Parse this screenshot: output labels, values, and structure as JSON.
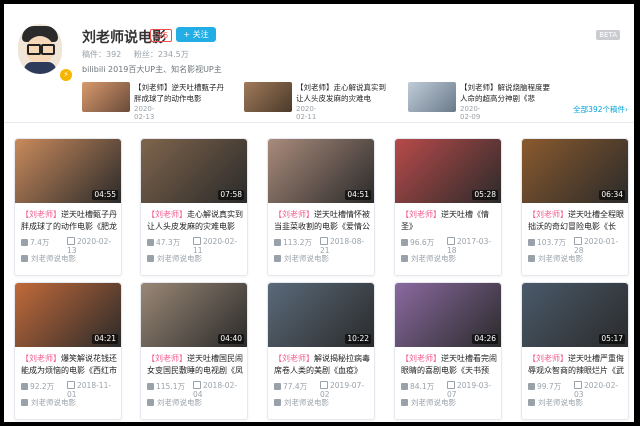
{
  "profile": {
    "name": "刘老师说电影",
    "level": "LV6",
    "follow_label": "+ 关注",
    "beta": "BETA",
    "uploads_label": "稿件：392",
    "fans_label": "粉丝：234.5万",
    "sign": "bilibili 2019百大UP主、知名影视UP主"
  },
  "recent": [
    {
      "title": "【刘老师】逆天吐槽甄子丹胖成球了的动作电影",
      "date": "2020-02-13",
      "color": "#c98a5c"
    },
    {
      "title": "【刘老师】走心解说真实到让人头皮发麻的灾难电",
      "date": "2020-02-11",
      "color": "#8a6a4e"
    },
    {
      "title": "【刘老师】解说烧脑程度要人命的超高分神剧《悲",
      "date": "2020-02-09",
      "color": "#a0b0c0"
    }
  ],
  "all_videos_link": "全部392个稿件›",
  "videos": [
    {
      "tag": "【刘老师】",
      "title": "逆天吐槽甄子丹胖成球了的动作电影《肥龙",
      "views": "7.4万",
      "date": "2020-02-13",
      "duration": "04:55",
      "owner": "刘老师说电影",
      "color": "#c98a5c"
    },
    {
      "tag": "【刘老师】",
      "title": "走心解说真实到让人头皮发麻的灾难电影",
      "views": "47.3万",
      "date": "2020-02-11",
      "duration": "07:58",
      "owner": "刘老师说电影",
      "color": "#7f654c"
    },
    {
      "tag": "【刘老师】",
      "title": "逆天吐槽情怀被当韭菜收割的电影《爱情公",
      "views": "113.2万",
      "date": "2018-08-21",
      "duration": "04:51",
      "owner": "刘老师说电影",
      "color": "#a98b7b"
    },
    {
      "tag": "【刘老师】",
      "title": "逆天吐槽《情圣》",
      "views": "96.6万",
      "date": "2017-03-18",
      "duration": "05:28",
      "owner": "刘老师说电影",
      "color": "#b84a4a"
    },
    {
      "tag": "【刘老师】",
      "title": "逆天吐槽全程眼拙沃的奇幻冒险电影《长",
      "views": "103.7万",
      "date": "2020-01-28",
      "duration": "06:34",
      "owner": "刘老师说电影",
      "color": "#8a5a2e"
    },
    {
      "tag": "【刘老师】",
      "title": "爆笑解说花钱还能成为烦恼的电影《西红市",
      "views": "92.2万",
      "date": "2018-11-01",
      "duration": "04:21",
      "owner": "刘老师说电影",
      "color": "#c26a3a"
    },
    {
      "tag": "【刘老师】",
      "title": "逆天吐槽国民闹女变国民敷睡的电视剧《凤",
      "views": "115.1万",
      "date": "2018-02-04",
      "duration": "04:40",
      "owner": "刘老师说电影",
      "color": "#9a8876"
    },
    {
      "tag": "【刘老师】",
      "title": "解说揭秘拉病毒席卷人类的美剧《血疫》",
      "views": "77.4万",
      "date": "2019-07-02",
      "duration": "10:22",
      "owner": "刘老师说电影",
      "color": "#5a6a7a"
    },
    {
      "tag": "【刘老师】",
      "title": "逆天吐槽看完闹眼睛的喜剧电影《天书预",
      "views": "84.1万",
      "date": "2019-03-07",
      "duration": "04:26",
      "owner": "刘老师说电影",
      "color": "#8a6aa0"
    },
    {
      "tag": "【刘老师】",
      "title": "逆天吐槽严重侮辱观众智商的辣眼烂片《武",
      "views": "99.7万",
      "date": "2020-02-03",
      "duration": "05:17",
      "owner": "刘老师说电影",
      "color": "#4a5a6a"
    }
  ]
}
